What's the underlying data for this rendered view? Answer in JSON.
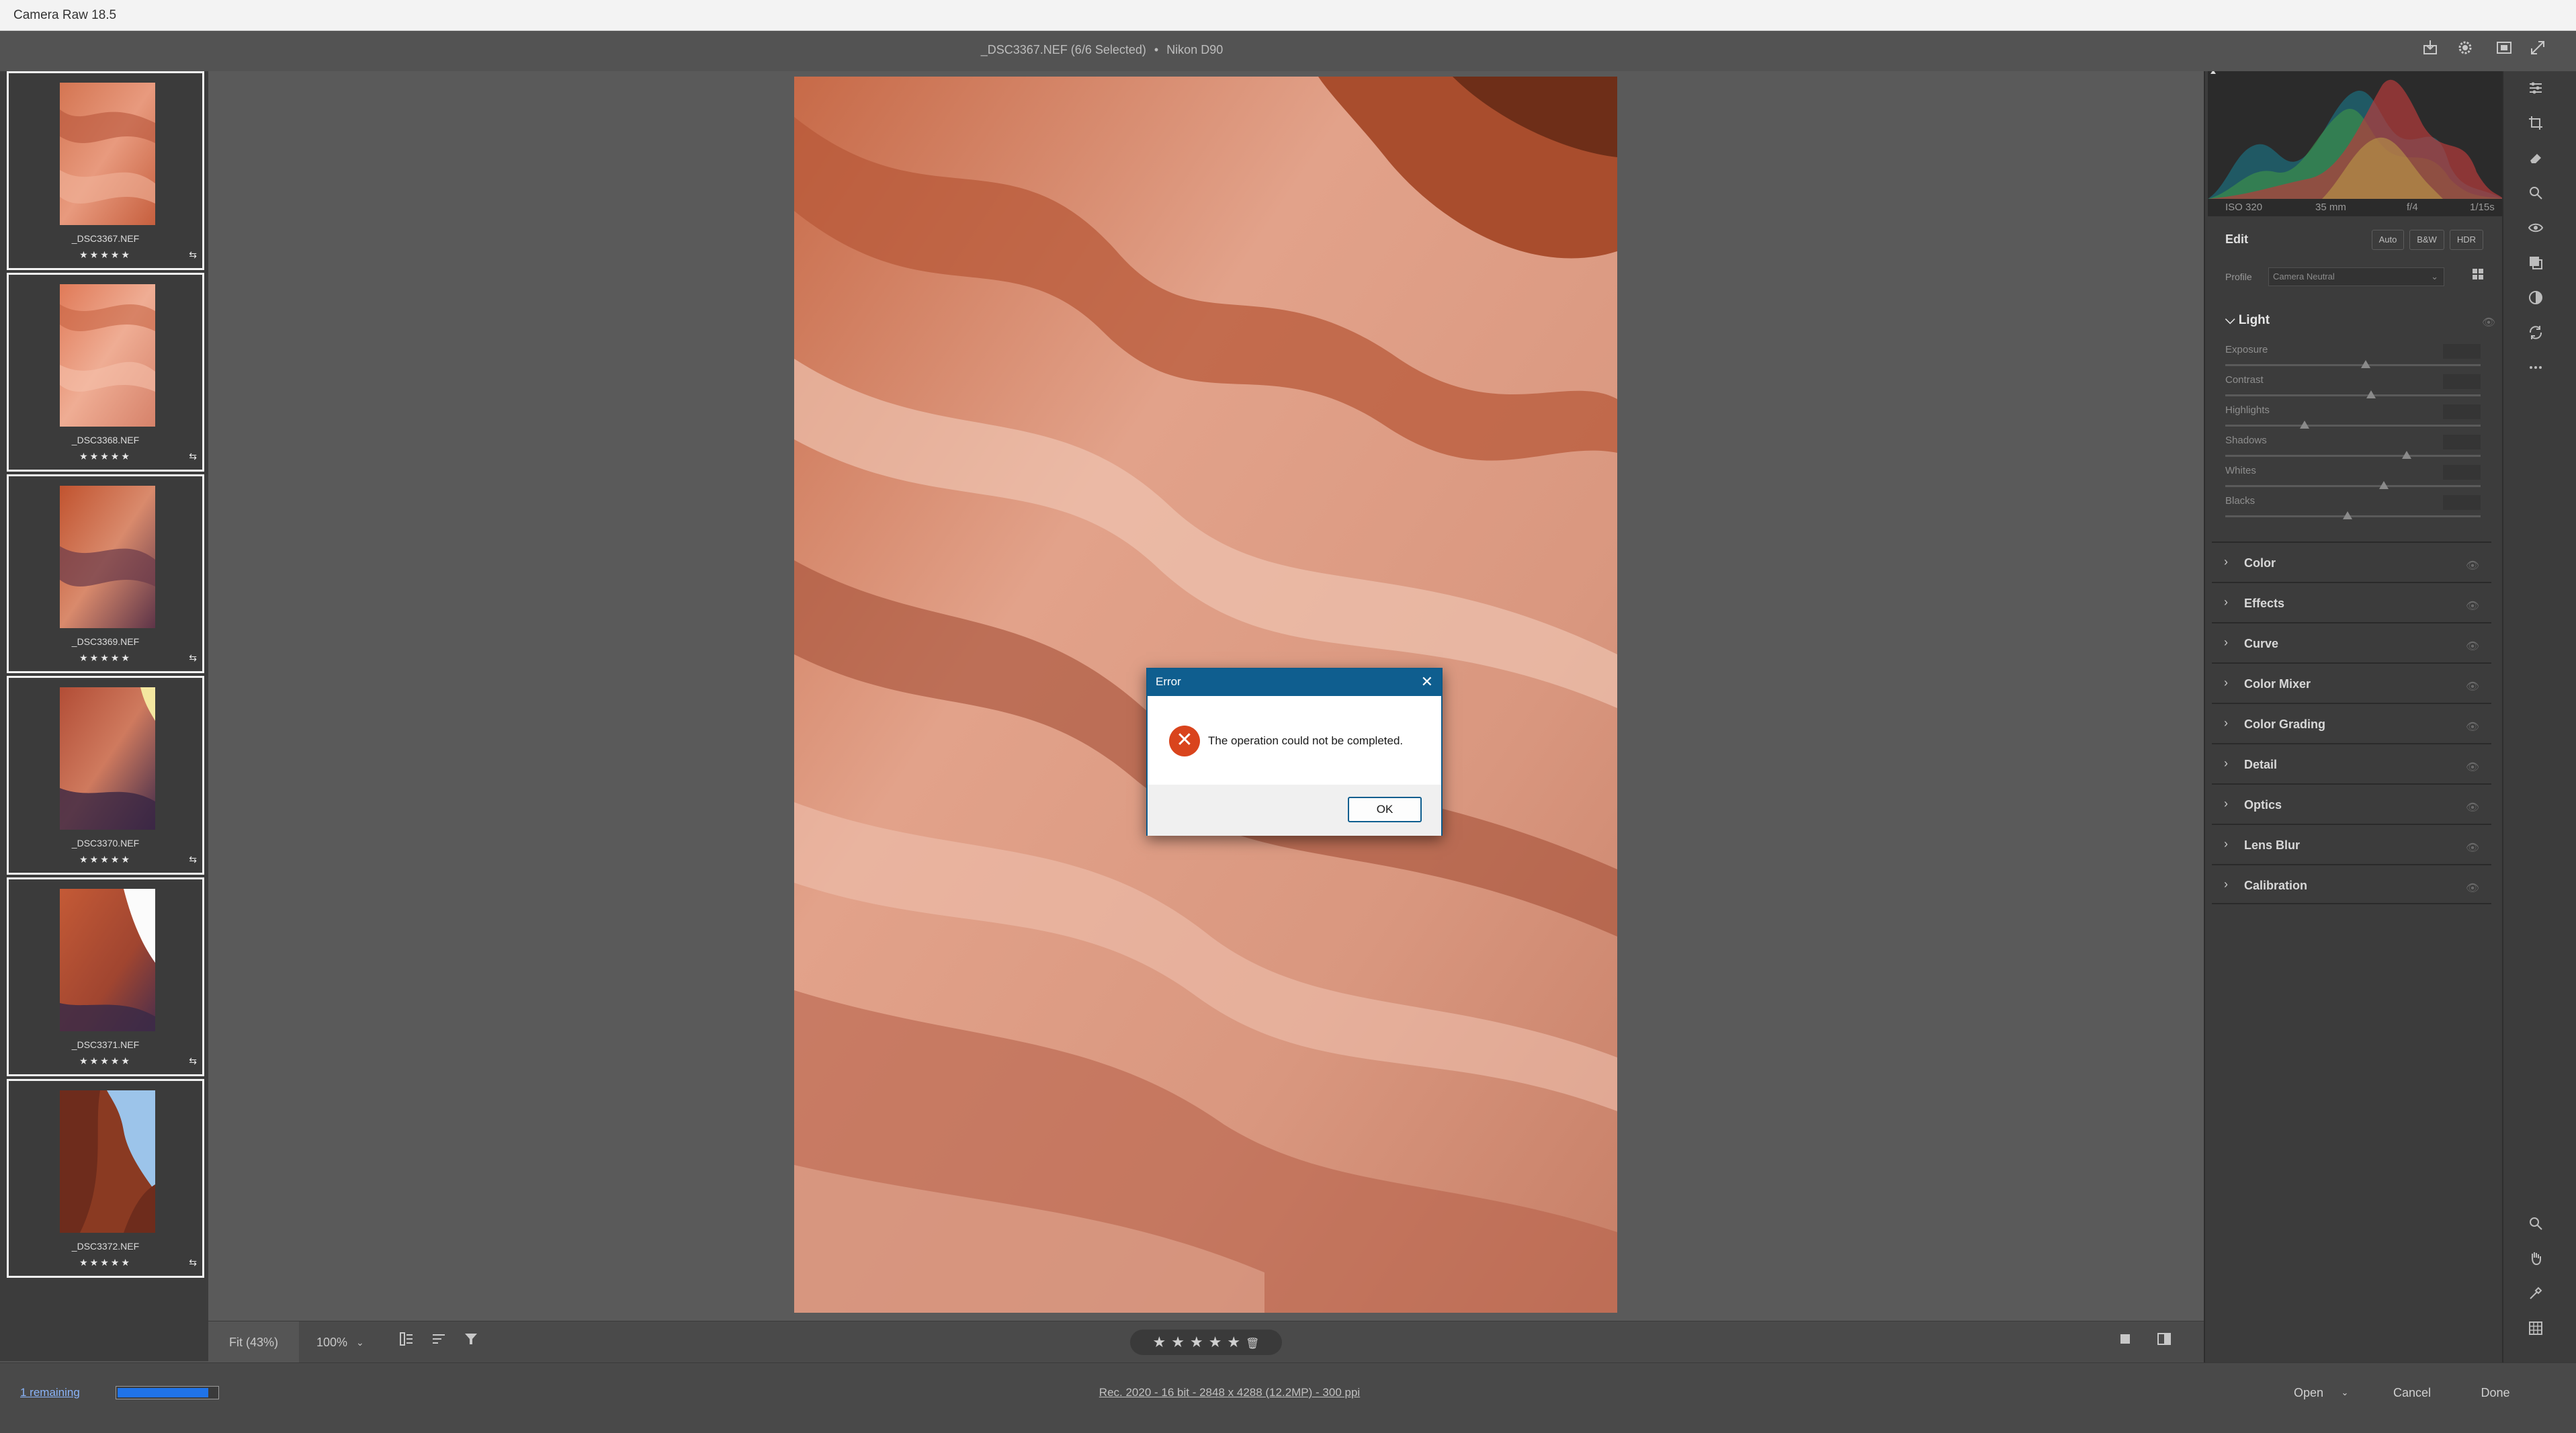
{
  "window": {
    "title": "Camera Raw 18.5"
  },
  "header": {
    "filename": "_DSC3367.NEF (6/6 Selected)",
    "separator": "•",
    "camera": "Nikon D90"
  },
  "filmstrip": {
    "items": [
      {
        "name": "_DSC3367.NEF",
        "stars": "★★★★★",
        "selected": true
      },
      {
        "name": "_DSC3368.NEF",
        "stars": "★★★★★",
        "selected": true
      },
      {
        "name": "_DSC3369.NEF",
        "stars": "★★★★★",
        "selected": true
      },
      {
        "name": "_DSC3370.NEF",
        "stars": "★★★★★",
        "selected": true
      },
      {
        "name": "_DSC3371.NEF",
        "stars": "★★★★★",
        "selected": true
      },
      {
        "name": "_DSC3372.NEF",
        "stars": "★★★★★",
        "selected": true
      }
    ],
    "sync_icon": "⇆"
  },
  "bottom_toolbar": {
    "zoom_fit": "Fit (43%)",
    "zoom_100": "100%",
    "zoom_dropdown": "⌄",
    "rating": "★★★★★",
    "trash": "🗑"
  },
  "status": {
    "remaining": "1 remaining",
    "progress_fraction": 0.9,
    "workflow_info": "Rec. 2020 - 16 bit - 2848 x 4288 (12.2MP) - 300 ppi",
    "open_label": "Open",
    "open_dropdown": "⌄",
    "cancel_label": "Cancel",
    "done_label": "Done"
  },
  "histogram": {
    "iso": "ISO 320",
    "focal": "35 mm",
    "aperture": "f/4",
    "shutter": "1/15s"
  },
  "edit_panel": {
    "title": "Edit",
    "auto": "Auto",
    "bw": "B&W",
    "hdr": "HDR",
    "profile_label": "Profile",
    "profile_value": "Camera Neutral",
    "light_section": "Light",
    "sliders": [
      {
        "label": "Exposure",
        "position": 0.55
      },
      {
        "label": "Contrast",
        "position": 0.57
      },
      {
        "label": "Highlights",
        "position": 0.31
      },
      {
        "label": "Shadows",
        "position": 0.71
      },
      {
        "label": "Whites",
        "position": 0.62
      },
      {
        "label": "Blacks",
        "position": 0.48
      }
    ],
    "sections": [
      "Color",
      "Effects",
      "Curve",
      "Color Mixer",
      "Color Grading",
      "Detail",
      "Optics",
      "Lens Blur",
      "Calibration"
    ]
  },
  "dialog": {
    "title": "Error",
    "message": "The operation could not be completed.",
    "ok_label": "OK",
    "close": "✕",
    "error_glyph": "✕"
  },
  "colors": {
    "dialog_header": "#0f5e8f",
    "error_icon": "#d9441d",
    "progress_fill": "#1f73e8"
  }
}
